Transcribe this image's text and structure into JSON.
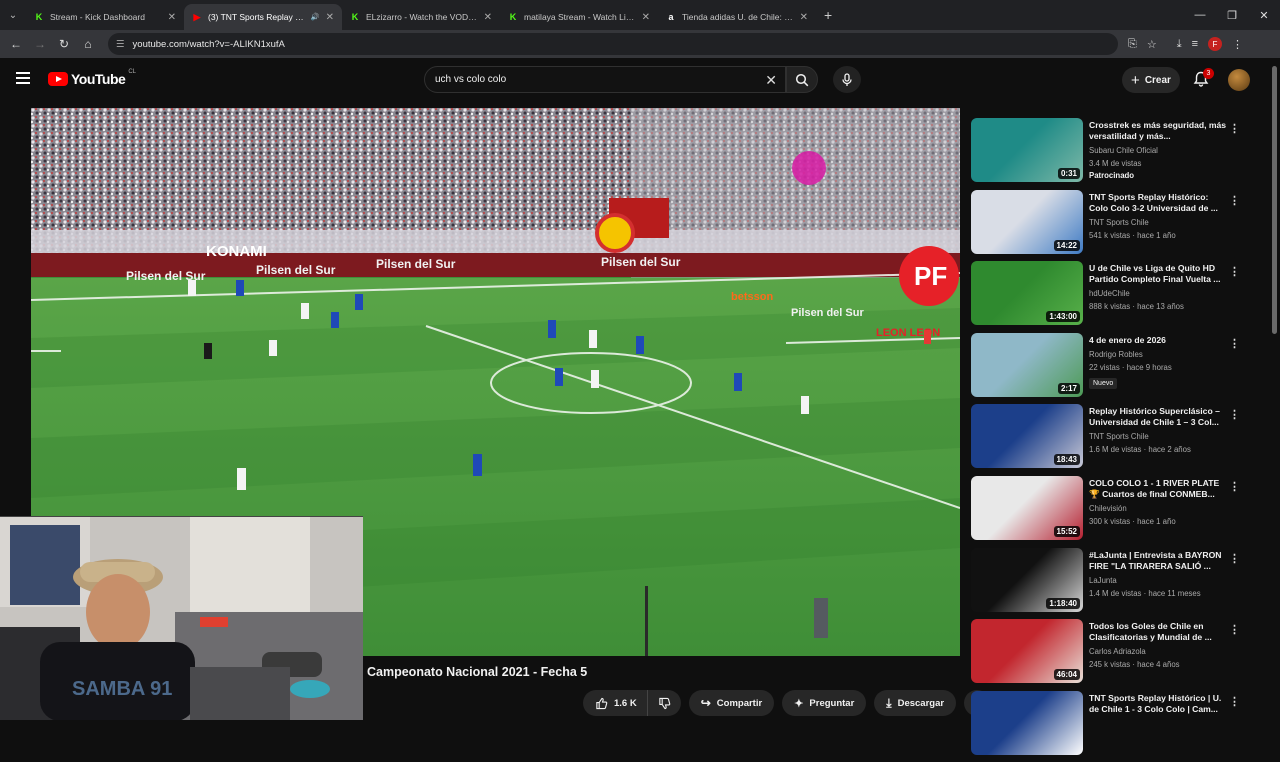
{
  "browser": {
    "tabs": [
      {
        "title": "Stream - Kick Dashboard",
        "fav_color": "#53fc18",
        "fav_glyph": "K",
        "active": false
      },
      {
        "title": "(3) TNT Sports Replay Histó",
        "fav_color": "#ff0000",
        "fav_glyph": "▶",
        "active": true
      },
      {
        "title": "ELzizarro - Watch the VOD on",
        "fav_color": "#53fc18",
        "fav_glyph": "K",
        "active": false
      },
      {
        "title": "matilaya Stream - Watch Live o",
        "fav_color": "#53fc18",
        "fav_glyph": "K",
        "active": false
      },
      {
        "title": "Tienda adidas U. de Chile: Cam",
        "fav_color": "#ffffff",
        "fav_glyph": "a",
        "active": false
      }
    ],
    "url": "youtube.com/watch?v=-ALIKN1xufA",
    "profile_initial": "F"
  },
  "header": {
    "logo_text": "YouTube",
    "country": "CL",
    "search_value": "uch vs colo colo",
    "create_label": "Crear",
    "notifications": "3"
  },
  "video": {
    "title": "Campeonato Nacional 2021 - Fecha 5",
    "likes": "1.6 K",
    "share_label": "Compartir",
    "ask_label": "Preguntar",
    "download_label": "Descargar",
    "ads": [
      "Pilsen del Sur",
      "KONAMI",
      "Pilsen del Sur",
      "Pilsen del Sur",
      "Pilsen del Sur",
      "betsson",
      "Pilsen del Sur",
      "LEON LEON"
    ]
  },
  "recommendations": [
    {
      "title": "Crosstrek es más seguridad, más versatilidad y más...",
      "channel": "Subaru Chile Oficial",
      "stats": "3.4 M de vistas",
      "extra": "Patrocinado",
      "duration": "0:31",
      "thumb": [
        "#1f8b87",
        "#7fb9a8"
      ]
    },
    {
      "title": "TNT Sports Replay Histórico: Colo Colo 3-2 Universidad de ...",
      "channel": "TNT Sports Chile",
      "stats": "541 k vistas · hace 1 año",
      "duration": "14:22",
      "thumb": [
        "#d9dde6",
        "#3f7bc4"
      ]
    },
    {
      "title": "U de Chile vs Liga de Quito HD Partido Completo Final Vuelta ...",
      "channel": "hdUdeChile",
      "stats": "888 k vistas · hace 13 años",
      "duration": "1:43:00",
      "thumb": [
        "#2f8a2f",
        "#58b04a"
      ]
    },
    {
      "title": "4 de enero de 2026",
      "channel": "Rodrigo Robles",
      "stats": "22 vistas · hace 9 horas",
      "badge": "Nuevo",
      "duration": "2:17",
      "thumb": [
        "#8fb8c8",
        "#4d9a55"
      ]
    },
    {
      "title": "Replay Histórico Superclásico – Universidad de Chile 1 – 3 Col...",
      "channel": "TNT Sports Chile",
      "stats": "1.6 M de vistas · hace 2 años",
      "duration": "18:43",
      "thumb": [
        "#1c3f8a",
        "#c9c9d6"
      ]
    },
    {
      "title": "COLO COLO 1 - 1 RIVER PLATE 🏆 Cuartos de final CONMEB...",
      "channel": "Chilevisión",
      "stats": "300 k vistas · hace 1 año",
      "duration": "15:52",
      "thumb": [
        "#e8e8e8",
        "#b52030"
      ]
    },
    {
      "title": "#LaJunta | Entrevista a BAYRON FIRE \"LA TIRARERA SALIÓ ...",
      "channel": "LaJunta",
      "stats": "1.4 M de vistas · hace 11 meses",
      "duration": "1:18:40",
      "thumb": [
        "#111111",
        "#d8d8d8"
      ]
    },
    {
      "title": "Todos los Goles de Chile en Clasificatorias y Mundial de ...",
      "channel": "Carlos Adriazola",
      "stats": "245 k vistas · hace 4 años",
      "duration": "46:04",
      "thumb": [
        "#c2262e",
        "#e8e0d8"
      ]
    },
    {
      "title": "TNT Sports Replay Histórico | U. de Chile 1 - 3 Colo Colo | Cam...",
      "channel": "",
      "stats": "",
      "duration": "",
      "thumb": [
        "#1c3f8a",
        "#ffffff"
      ]
    }
  ]
}
